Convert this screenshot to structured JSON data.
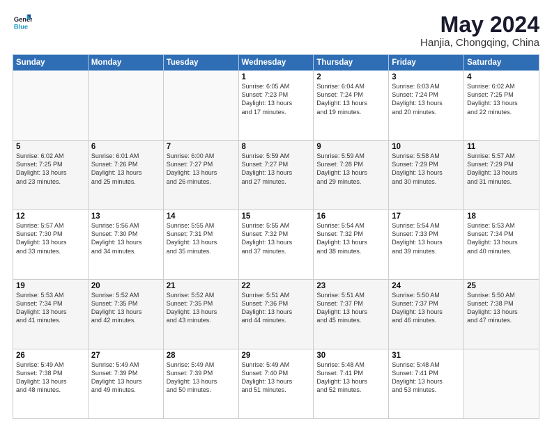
{
  "logo": {
    "line1": "General",
    "line2": "Blue"
  },
  "title": "May 2024",
  "subtitle": "Hanjia, Chongqing, China",
  "weekdays": [
    "Sunday",
    "Monday",
    "Tuesday",
    "Wednesday",
    "Thursday",
    "Friday",
    "Saturday"
  ],
  "weeks": [
    [
      {
        "day": "",
        "info": ""
      },
      {
        "day": "",
        "info": ""
      },
      {
        "day": "",
        "info": ""
      },
      {
        "day": "1",
        "info": "Sunrise: 6:05 AM\nSunset: 7:23 PM\nDaylight: 13 hours\nand 17 minutes."
      },
      {
        "day": "2",
        "info": "Sunrise: 6:04 AM\nSunset: 7:24 PM\nDaylight: 13 hours\nand 19 minutes."
      },
      {
        "day": "3",
        "info": "Sunrise: 6:03 AM\nSunset: 7:24 PM\nDaylight: 13 hours\nand 20 minutes."
      },
      {
        "day": "4",
        "info": "Sunrise: 6:02 AM\nSunset: 7:25 PM\nDaylight: 13 hours\nand 22 minutes."
      }
    ],
    [
      {
        "day": "5",
        "info": "Sunrise: 6:02 AM\nSunset: 7:25 PM\nDaylight: 13 hours\nand 23 minutes."
      },
      {
        "day": "6",
        "info": "Sunrise: 6:01 AM\nSunset: 7:26 PM\nDaylight: 13 hours\nand 25 minutes."
      },
      {
        "day": "7",
        "info": "Sunrise: 6:00 AM\nSunset: 7:27 PM\nDaylight: 13 hours\nand 26 minutes."
      },
      {
        "day": "8",
        "info": "Sunrise: 5:59 AM\nSunset: 7:27 PM\nDaylight: 13 hours\nand 27 minutes."
      },
      {
        "day": "9",
        "info": "Sunrise: 5:59 AM\nSunset: 7:28 PM\nDaylight: 13 hours\nand 29 minutes."
      },
      {
        "day": "10",
        "info": "Sunrise: 5:58 AM\nSunset: 7:29 PM\nDaylight: 13 hours\nand 30 minutes."
      },
      {
        "day": "11",
        "info": "Sunrise: 5:57 AM\nSunset: 7:29 PM\nDaylight: 13 hours\nand 31 minutes."
      }
    ],
    [
      {
        "day": "12",
        "info": "Sunrise: 5:57 AM\nSunset: 7:30 PM\nDaylight: 13 hours\nand 33 minutes."
      },
      {
        "day": "13",
        "info": "Sunrise: 5:56 AM\nSunset: 7:30 PM\nDaylight: 13 hours\nand 34 minutes."
      },
      {
        "day": "14",
        "info": "Sunrise: 5:55 AM\nSunset: 7:31 PM\nDaylight: 13 hours\nand 35 minutes."
      },
      {
        "day": "15",
        "info": "Sunrise: 5:55 AM\nSunset: 7:32 PM\nDaylight: 13 hours\nand 37 minutes."
      },
      {
        "day": "16",
        "info": "Sunrise: 5:54 AM\nSunset: 7:32 PM\nDaylight: 13 hours\nand 38 minutes."
      },
      {
        "day": "17",
        "info": "Sunrise: 5:54 AM\nSunset: 7:33 PM\nDaylight: 13 hours\nand 39 minutes."
      },
      {
        "day": "18",
        "info": "Sunrise: 5:53 AM\nSunset: 7:34 PM\nDaylight: 13 hours\nand 40 minutes."
      }
    ],
    [
      {
        "day": "19",
        "info": "Sunrise: 5:53 AM\nSunset: 7:34 PM\nDaylight: 13 hours\nand 41 minutes."
      },
      {
        "day": "20",
        "info": "Sunrise: 5:52 AM\nSunset: 7:35 PM\nDaylight: 13 hours\nand 42 minutes."
      },
      {
        "day": "21",
        "info": "Sunrise: 5:52 AM\nSunset: 7:35 PM\nDaylight: 13 hours\nand 43 minutes."
      },
      {
        "day": "22",
        "info": "Sunrise: 5:51 AM\nSunset: 7:36 PM\nDaylight: 13 hours\nand 44 minutes."
      },
      {
        "day": "23",
        "info": "Sunrise: 5:51 AM\nSunset: 7:37 PM\nDaylight: 13 hours\nand 45 minutes."
      },
      {
        "day": "24",
        "info": "Sunrise: 5:50 AM\nSunset: 7:37 PM\nDaylight: 13 hours\nand 46 minutes."
      },
      {
        "day": "25",
        "info": "Sunrise: 5:50 AM\nSunset: 7:38 PM\nDaylight: 13 hours\nand 47 minutes."
      }
    ],
    [
      {
        "day": "26",
        "info": "Sunrise: 5:49 AM\nSunset: 7:38 PM\nDaylight: 13 hours\nand 48 minutes."
      },
      {
        "day": "27",
        "info": "Sunrise: 5:49 AM\nSunset: 7:39 PM\nDaylight: 13 hours\nand 49 minutes."
      },
      {
        "day": "28",
        "info": "Sunrise: 5:49 AM\nSunset: 7:39 PM\nDaylight: 13 hours\nand 50 minutes."
      },
      {
        "day": "29",
        "info": "Sunrise: 5:49 AM\nSunset: 7:40 PM\nDaylight: 13 hours\nand 51 minutes."
      },
      {
        "day": "30",
        "info": "Sunrise: 5:48 AM\nSunset: 7:41 PM\nDaylight: 13 hours\nand 52 minutes."
      },
      {
        "day": "31",
        "info": "Sunrise: 5:48 AM\nSunset: 7:41 PM\nDaylight: 13 hours\nand 53 minutes."
      },
      {
        "day": "",
        "info": ""
      }
    ]
  ]
}
